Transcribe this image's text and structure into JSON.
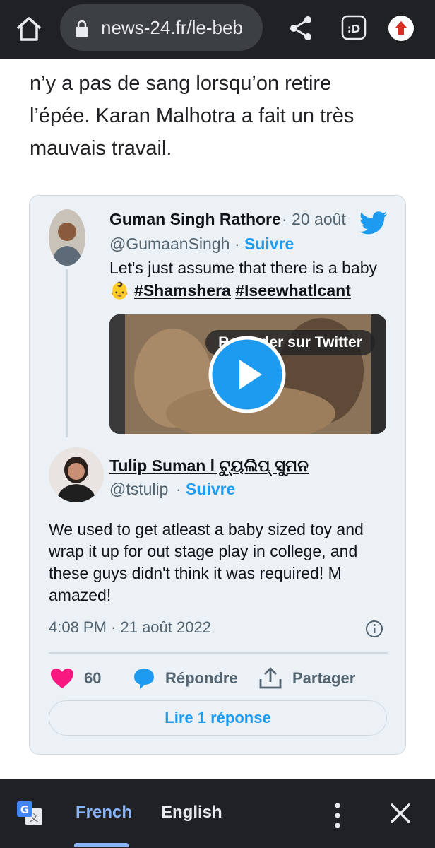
{
  "browser": {
    "url": "news-24.fr/le-beb",
    "icons": [
      "home-icon",
      "lock-icon",
      "share-icon",
      "extension-icon",
      "upload-icon"
    ]
  },
  "article": {
    "line1": "n’y a pas de sang lorsqu’on retire",
    "line2": "l’épée. Karan Malhotra a fait un très",
    "line3": "mauvais travail."
  },
  "quoted_tweet": {
    "name": "Guman Singh Rathore",
    "date": "· 20 août",
    "handle": "@GumaanSingh",
    "sep": "·",
    "follow": "Suivre",
    "text": "Let's just assume that there is a baby",
    "emoji": "👶",
    "hashtag1": "#Shamshera",
    "hashtag2": "#Iseewhatlcant",
    "video_label": "Regarder sur Twitter"
  },
  "main_tweet": {
    "name": "Tulip Suman l ଟ୍ୟୁଲିପ୍ ସୁମନ",
    "handle": "@tstulip",
    "sep": "·",
    "follow": "Suivre",
    "text": "We used to get atleast a baby sized toy and wrap it up for out stage play in college, and these guys didn't think it was required! M amazed!",
    "time": "4:08 PM · 21 août 2022",
    "likes": "60",
    "reply_label": "Répondre",
    "share_label": "Partager",
    "read_replies": "Lire 1 réponse"
  },
  "translate_bar": {
    "tab_source": "French",
    "tab_target": "English"
  },
  "colors": {
    "twitter_blue": "#1d9bf0",
    "like_red": "#f91880",
    "card_bg": "#ecf1f6",
    "chrome_dark": "#202124",
    "translate_accent": "#8ab4f8"
  }
}
